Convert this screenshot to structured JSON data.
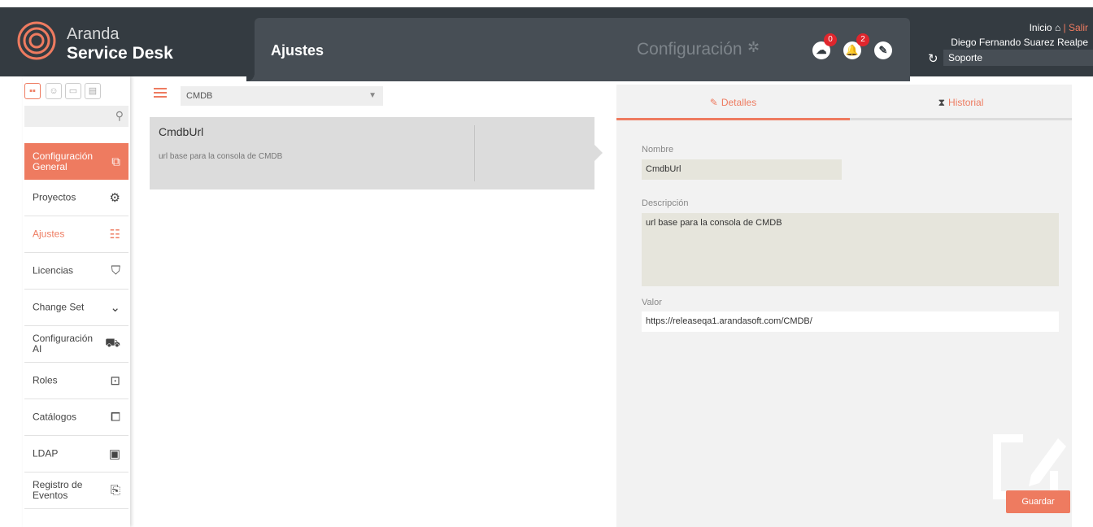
{
  "header": {
    "brand_top": "Aranda",
    "brand_bottom": "Service Desk",
    "section_title": "Ajustes",
    "config_title": "Configuración",
    "notifications": [
      {
        "icon": "cloud-download-icon",
        "count": "0"
      },
      {
        "icon": "bell-icon",
        "count": "2"
      },
      {
        "icon": "magic-wand-icon",
        "count": ""
      }
    ],
    "inicio": "Inicio",
    "salir": "| Salir",
    "user_name": "Diego Fernando Suarez Realpe",
    "role": "Soporte"
  },
  "sidebar": {
    "view_icons": [
      "grid-icon",
      "user-icon",
      "monitor-icon",
      "server-icon"
    ],
    "search_placeholder": "",
    "items": [
      {
        "label": "Configuración General",
        "icon": "copy-icon",
        "state": "highlighted"
      },
      {
        "label": "Proyectos",
        "icon": "gears-icon"
      },
      {
        "label": "Ajustes",
        "icon": "sliders-icon",
        "state": "current"
      },
      {
        "label": "Licencias",
        "icon": "shield-icon"
      },
      {
        "label": "Change Set",
        "icon": "chevron-down-icon"
      },
      {
        "label": "Configuración AI",
        "icon": "robot-icon"
      },
      {
        "label": "Roles",
        "icon": "id-badge-icon"
      },
      {
        "label": "Catálogos",
        "icon": "gallery-icon"
      },
      {
        "label": "LDAP",
        "icon": "folder-user-icon"
      },
      {
        "label": "Registro de Eventos",
        "icon": "clipboard-pulse-icon"
      }
    ]
  },
  "list": {
    "filter_value": "CMDB",
    "items": [
      {
        "name": "CmdbUrl",
        "description": "url base para la consola de CMDB"
      }
    ]
  },
  "detail": {
    "tabs": [
      {
        "label": "Detalles",
        "icon": "edit-icon"
      },
      {
        "label": "Historial",
        "icon": "hourglass-icon"
      }
    ],
    "name_label": "Nombre",
    "name_value": "CmdbUrl",
    "description_label": "Descripción",
    "description_value": "url base para la consola de CMDB",
    "value_label": "Valor",
    "value_value": "https://releaseqa1.arandasoft.com/CMDB/",
    "save_label": "Guardar"
  },
  "colors": {
    "accent": "#ee7b60",
    "header_bg": "#343b41",
    "panel_bg": "#474e55",
    "badge": "#e0262d"
  }
}
